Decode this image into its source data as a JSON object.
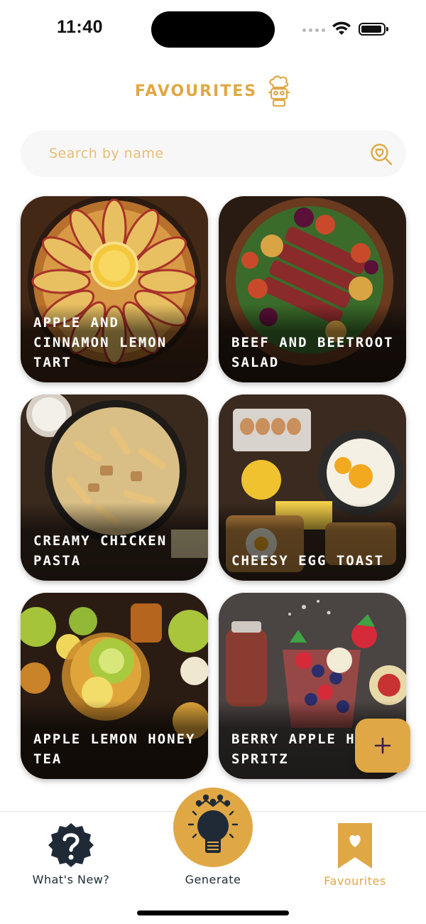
{
  "status_bar": {
    "time": "11:40"
  },
  "header": {
    "title": "FAVOURITES",
    "logo_icon": "chef-robot-icon"
  },
  "search": {
    "placeholder": "Search by name",
    "icon": "heart-search-icon"
  },
  "recipes": [
    {
      "name": "APPLE AND CINNAMON LEMON TART"
    },
    {
      "name": "BEEF AND BEETROOT SALAD"
    },
    {
      "name": "CREAMY CHICKEN PASTA"
    },
    {
      "name": "CHEESY EGG TOAST"
    },
    {
      "name": "APPLE LEMON HONEY TEA"
    },
    {
      "name": "BERRY APPLE HONEY SPRITZ"
    }
  ],
  "fab": {
    "icon": "plus-icon"
  },
  "bottom_nav": {
    "items": [
      {
        "label": "What's New?",
        "icon": "question-badge-icon",
        "active": false
      },
      {
        "label": "Generate",
        "icon": "lightbulb-crown-icon",
        "active": false
      },
      {
        "label": "Favourites",
        "icon": "heart-bookmark-icon",
        "active": true
      }
    ]
  },
  "colors": {
    "accent": "#e0a845",
    "dark": "#1f2a36",
    "placeholder": "#e7bd74",
    "search_bg": "#f7f7f7"
  }
}
